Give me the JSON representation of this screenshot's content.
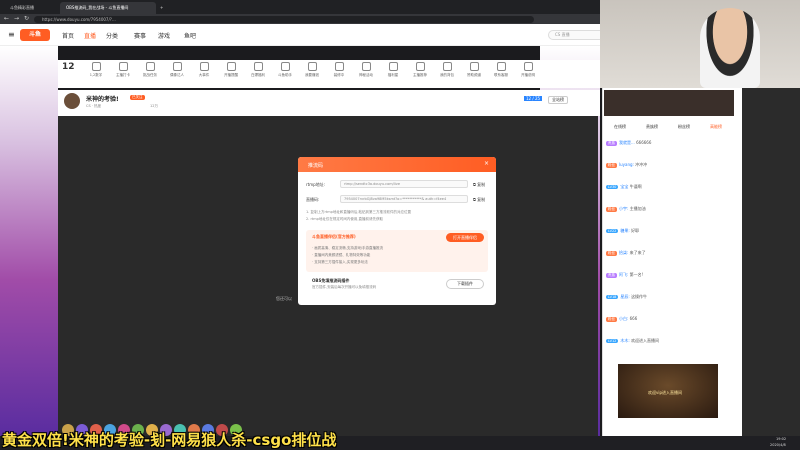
{
  "browser": {
    "tabs": [
      "斗鱼精彩直播",
      "OBS推流码_我在战场 - 斗鱼直播间"
    ],
    "url": "https://www.douyu.com/7954007/?...",
    "nav_icons": [
      "back-icon",
      "forward-icon",
      "reload-icon"
    ]
  },
  "site": {
    "logo": "斗鱼",
    "nav": [
      "首页",
      "直播",
      "分类",
      "赛事",
      "游戏",
      "鱼吧"
    ],
    "search_placeholder": "CS 直播"
  },
  "categories": [
    "1,2数字",
    "主播打卡",
    "挑战任务",
    "偶像达人",
    "大事件",
    "开播提醒",
    "白嫖福利",
    "斗鱼助手",
    "我要赚钱",
    "装修中",
    "神秘活动",
    "福利星",
    "主播推荐",
    "我的背包",
    "赞助频道",
    "联系客服",
    "开播说明"
  ],
  "streamer": {
    "room_badge": "12",
    "title": "米神的考验!",
    "tag": "已关注",
    "id_text": "CS · 热度",
    "hot": "12万",
    "follow": "全站榜",
    "fans": "12 / 25"
  },
  "video": {
    "status_text": "您还可以"
  },
  "modal": {
    "title": "推流码",
    "rtmp_label": "rtmp地址:",
    "rtmp_value": "rtmp://sendtc3a.douyu.com/live",
    "key_label": "直播码:",
    "key_value": "7954007rvrbGJ8va98M5ksmt?o=***********&  auth=f4ee4",
    "copy": "复制",
    "note1": "1. 复制上方rtmp地址和直播码后,粘贴到第三方推流软件的对应位置",
    "note2": "2. rtmp地址仅在规定时间内使用,直播前请先获取",
    "promo_title": "斗鱼直播伴侣(官方推荐)",
    "promo_btn": "打开直播伴侣",
    "promo_lines": [
      "· 画质高清、稳定流畅,支持游戏/手游直播推流",
      "· 直播间内美颜滤镜、礼物特效等功能",
      "· 支持第三方插件接入,实现更多玩法"
    ],
    "obs_title": "OBS免填推流码插件",
    "obs_desc": "官方插件,安装后每次开播可以免填推流码",
    "obs_btn": "下载插件"
  },
  "chat": {
    "tabs": [
      "在线榜",
      "贵族榜",
      "粉丝榜",
      "高能榜"
    ],
    "messages": [
      {
        "badge": "贵族",
        "user": "我就是...",
        "text": "666666"
      },
      {
        "badge": "粉丝",
        "user": "luyang:",
        "text": "冲冲冲"
      },
      {
        "badge": "LV30",
        "user": "宝宝",
        "text": "牛逼啊"
      },
      {
        "badge": "粉丝",
        "user": "小宇:",
        "text": "主播加油"
      },
      {
        "badge": "LV22",
        "user": "糖果:",
        "text": "好耶"
      },
      {
        "badge": "粉丝",
        "user": "拾柒:",
        "text": "来了来了"
      },
      {
        "badge": "贵族",
        "user": "阿飞:",
        "text": "第一名!"
      },
      {
        "badge": "LV18",
        "user": "星辰:",
        "text": "这操作牛"
      },
      {
        "badge": "粉丝",
        "user": "小白:",
        "text": "666"
      },
      {
        "badge": "LV12",
        "user": "木木:",
        "text": "欢迎进入直播间"
      }
    ],
    "welcome": "欢迎vip进入直播间"
  },
  "taskbar": {
    "time": "19:02",
    "date": "2020/4/8"
  },
  "caption": "黄金双倍!米神的考验-刬-网易狼人杀-csgo排位战"
}
